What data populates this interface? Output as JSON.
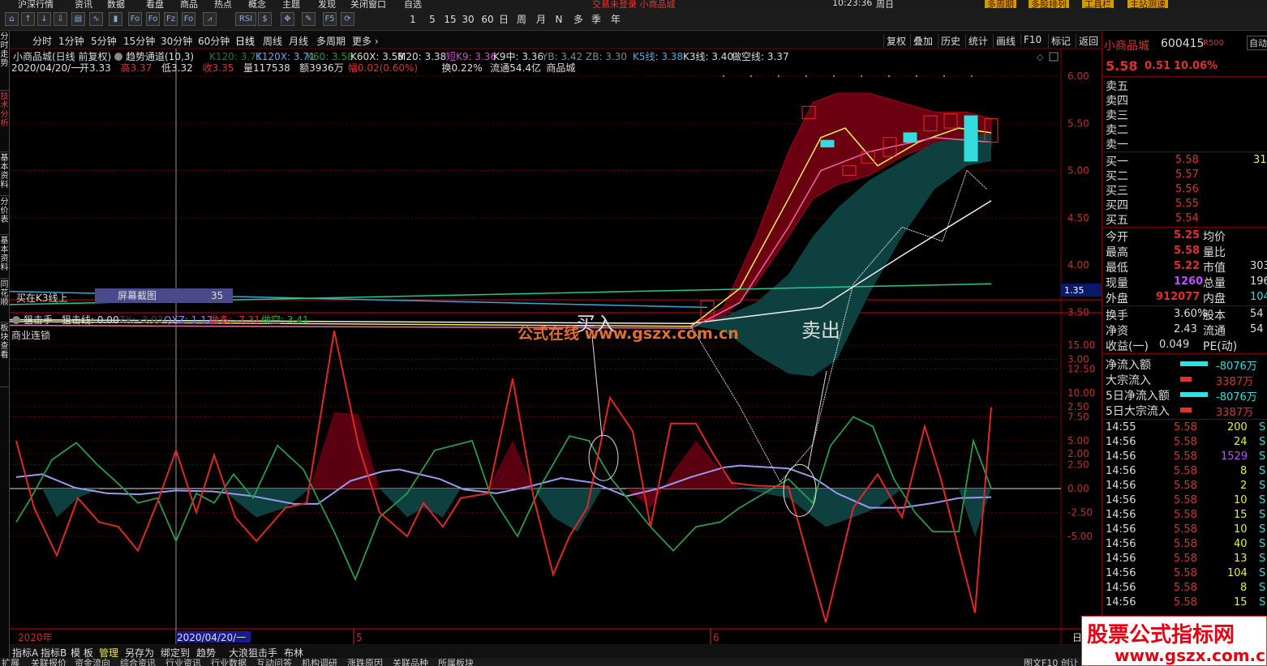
{
  "menu": [
    "沪深行情",
    "资讯",
    "数据",
    "看盘",
    "商品",
    "热点",
    "概念",
    "主题",
    "发现",
    "关闭窗口",
    "自选"
  ],
  "menu_right": [
    "多周期",
    "多股排列",
    "工具栏",
    "主站测速"
  ],
  "menu_title": "交易未登录  小商品城",
  "clock": {
    "time": "10:23:36",
    "day": "周日"
  },
  "toolbar_tabs": [
    "日",
    "周",
    "月",
    "N",
    "多",
    "季",
    "年"
  ],
  "toolbar_nums": [
    "1",
    "5",
    "15",
    "30",
    "60"
  ],
  "left_tabs": [
    "分时走势",
    "技术分析",
    "基本资料",
    "分价表",
    "基本资料",
    "同花顺",
    "板块查看"
  ],
  "periods": [
    "分时",
    "1分钟",
    "5分钟",
    "15分钟",
    "30分钟",
    "60分钟",
    "日线",
    "周线",
    "月线",
    "多周期",
    "更多"
  ],
  "period_tools": [
    "复权",
    "叠加",
    "历史",
    "统计",
    "画线",
    "F10",
    "标记",
    "返回"
  ],
  "main_header": {
    "name": "小商品城(日线 前复权)",
    "indicator": "趋势通道(10,3)",
    "k120": "K120: 3.71",
    "k120x": "K120X: 3.71",
    "k60": "K60: 3.58",
    "k60x": "K60X: 3.58",
    "m20": "M20: 3.38",
    "dk9": "短K9: 3.36",
    "k9z": "K9中: 3.36",
    "yb": "YB: 3.42",
    "zb": "ZB: 3.30",
    "k5": "K5线: 3.38",
    "k3": "K3线: 3.40",
    "zk": "做空线: 3.37"
  },
  "info_line": {
    "date": "2020/04/20/一",
    "open": "开3.33",
    "high": "高3.37",
    "low": "低3.32",
    "close": "收3.35",
    "vol": "量117538",
    "amt": "额3936万",
    "chg": "幅0.02(0.60%)",
    "turn": "换0.22%",
    "float": "流通54.4亿",
    "sector": "商品城"
  },
  "buy_label": "买在K3线上",
  "snap": {
    "label": "屏幕截图",
    "value": "35"
  },
  "price_tag": "1.35",
  "price_axis": [
    "6.00",
    "5.50",
    "5.00",
    "4.50",
    "4.00",
    "3.50",
    "3.00",
    "2.50",
    "2.00"
  ],
  "sub_header": {
    "name": "狙击手",
    "line": "狙击线: 0.00",
    "zx": "ZX: -3.03",
    "qxz": "QXZ: 1.12",
    "zd": "做多: -7.31",
    "zk": "做空: 3.41"
  },
  "sub_label": "商业连锁",
  "sub_axis": [
    "15.00",
    "12.50",
    "10.00",
    "7.50",
    "5.00",
    "2.50",
    "0.00",
    "-2.50",
    "-5.00"
  ],
  "annotations": {
    "buy": "买入",
    "sell": "卖出",
    "site": "公式在线 www.gszx.com.cn"
  },
  "time_axis": {
    "year": "2020年",
    "cursor": "2020/04/20/一",
    "m5": "5",
    "m6": "6",
    "right": "日"
  },
  "bottom_tabs": [
    "指标A",
    "指标B",
    "模 板",
    "管理",
    "另存为",
    "绑定到",
    "趋势",
    "大浪",
    "狙击手",
    "布林"
  ],
  "bottom_tabs2": [
    "扩展",
    "关联报价",
    "资金流向",
    "综合资讯",
    "行业资讯",
    "行业数据",
    "互动问答",
    "机构调研",
    "涨跌原因",
    "关联品种",
    "所属板块"
  ],
  "bottom_right": "图文F10 创让",
  "quote": {
    "name": "小商品城",
    "code": "600415",
    "badge": "R500",
    "price": "5.58",
    "chg": "0.51",
    "pct": "10.06%",
    "sells": [
      "卖五",
      "卖四",
      "卖三",
      "卖二",
      "卖一"
    ],
    "buys": [
      {
        "l": "买一",
        "p": "5.58",
        "v": "31"
      },
      {
        "l": "买二",
        "p": "5.57",
        "v": ""
      },
      {
        "l": "买三",
        "p": "5.56",
        "v": ""
      },
      {
        "l": "买四",
        "p": "5.55",
        "v": ""
      },
      {
        "l": "买五",
        "p": "5.54",
        "v": ""
      }
    ],
    "stats": [
      {
        "l": "今开",
        "v": "5.25",
        "l2": "均价",
        "v2": ""
      },
      {
        "l": "最高",
        "v": "5.58",
        "l2": "量比",
        "v2": ""
      },
      {
        "l": "最低",
        "v": "5.22",
        "l2": "市值",
        "v2": "303"
      },
      {
        "l": "现量",
        "v": "1260",
        "l2": "总量",
        "v2": "196"
      },
      {
        "l": "外盘",
        "v": "912077",
        "l2": "内盘",
        "v2": "104"
      }
    ],
    "stats2": [
      {
        "l": "换手",
        "v": "3.60%",
        "l2": "股本",
        "v2": "54"
      },
      {
        "l": "净资",
        "v": "2.43",
        "l2": "流通",
        "v2": "54"
      },
      {
        "l": "收益(一)",
        "v": "0.049",
        "l2": "PE(动)",
        "v2": ""
      }
    ],
    "flows": [
      {
        "l": "净流入额",
        "v": "-8076万",
        "c": "#33e0e0",
        "w": 34
      },
      {
        "l": "大宗流入",
        "v": "3387万",
        "c": "#e03030",
        "w": 14
      },
      {
        "l": "5日净流入额",
        "v": "-8076万",
        "c": "#33e0e0",
        "w": 34
      },
      {
        "l": "5日大宗流入",
        "v": "3387万",
        "c": "#e03030",
        "w": 14
      }
    ],
    "ticks": [
      [
        "14:55",
        "5.58",
        "200"
      ],
      [
        "14:56",
        "5.58",
        "24"
      ],
      [
        "14:56",
        "5.58",
        "1529"
      ],
      [
        "14:56",
        "5.58",
        "8"
      ],
      [
        "14:56",
        "5.58",
        "2"
      ],
      [
        "14:56",
        "5.58",
        "10"
      ],
      [
        "14:56",
        "5.58",
        "15"
      ],
      [
        "14:56",
        "5.58",
        "10"
      ],
      [
        "14:56",
        "5.58",
        "40"
      ],
      [
        "14:56",
        "5.58",
        "13"
      ],
      [
        "14:56",
        "5.58",
        "104"
      ],
      [
        "14:56",
        "5.58",
        "8"
      ],
      [
        "14:56",
        "5.58",
        "15"
      ]
    ],
    "tick_flag": "S",
    "auto": "自动"
  },
  "corner_logo": {
    "title": "股票公式指标网",
    "url": "www.gszx.com.cn"
  }
}
